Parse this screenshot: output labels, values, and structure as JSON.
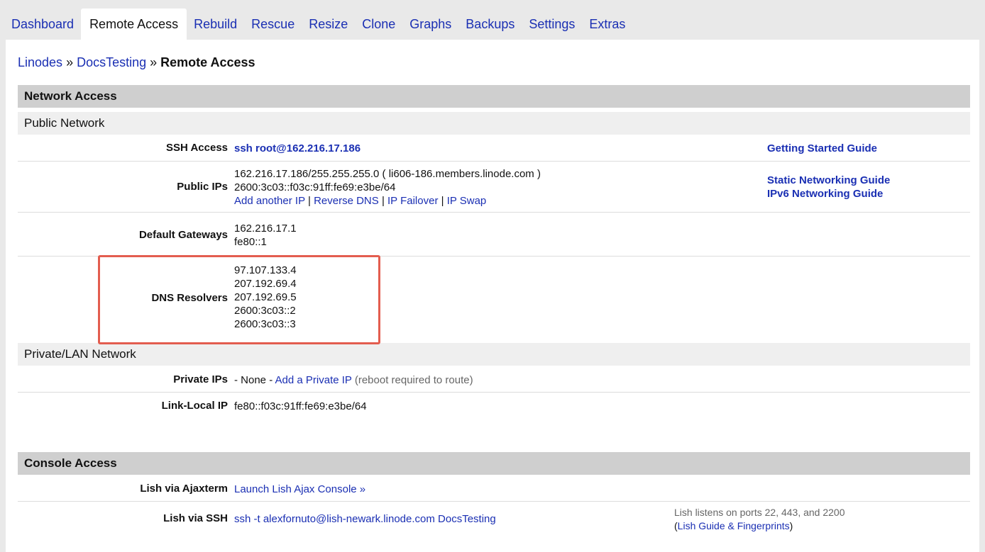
{
  "tabs": [
    {
      "label": "Dashboard"
    },
    {
      "label": "Remote Access",
      "active": true
    },
    {
      "label": "Rebuild"
    },
    {
      "label": "Rescue"
    },
    {
      "label": "Resize"
    },
    {
      "label": "Clone"
    },
    {
      "label": "Graphs"
    },
    {
      "label": "Backups"
    },
    {
      "label": "Settings"
    },
    {
      "label": "Extras"
    }
  ],
  "breadcrumb": {
    "linodes": "Linodes",
    "separator": "»",
    "node": "DocsTesting",
    "current": "Remote Access"
  },
  "network_access": {
    "title": "Network Access",
    "public_network": "Public Network",
    "ssh_access": {
      "label": "SSH Access",
      "value": "ssh root@162.216.17.186",
      "guide": "Getting Started Guide"
    },
    "public_ips": {
      "label": "Public IPs",
      "ipv4": "162.216.17.186/255.255.255.0 ( li606-186.members.linode.com )",
      "ipv6": "2600:3c03::f03c:91ff:fe69:e3be/64",
      "actions": [
        "Add another IP",
        "Reverse DNS",
        "IP Failover",
        "IP Swap"
      ],
      "action_separator": "|",
      "guides": [
        "Static Networking Guide",
        "IPv6 Networking Guide"
      ]
    },
    "default_gateways": {
      "label": "Default Gateways",
      "values": [
        "162.216.17.1",
        "fe80::1"
      ]
    },
    "dns_resolvers": {
      "label": "DNS Resolvers",
      "values": [
        "97.107.133.4",
        "207.192.69.4",
        "207.192.69.5",
        "2600:3c03::2",
        "2600:3c03::3"
      ],
      "highlight_color": "#e35d4f"
    },
    "private_network": "Private/LAN Network",
    "private_ips": {
      "label": "Private IPs",
      "none": "- None -",
      "add": "Add a Private IP",
      "note": "(reboot required to route)"
    },
    "link_local": {
      "label": "Link-Local IP",
      "value": "fe80::f03c:91ff:fe69:e3be/64"
    }
  },
  "console_access": {
    "title": "Console Access",
    "ajaxterm": {
      "label": "Lish via Ajaxterm",
      "link": "Launch Lish Ajax Console »"
    },
    "ssh": {
      "label": "Lish via SSH",
      "value": "ssh -t alexfornuto@lish-newark.linode.com DocsTesting",
      "note": "Lish listens on ports 22, 443, and 2200",
      "guide_open": "(",
      "guide": "Lish Guide & Fingerprints",
      "guide_close": ")"
    }
  },
  "colors": {
    "link": "#1a2fb3",
    "section_header": "#cfcfcf",
    "sub_header": "#efefef",
    "highlight": "#e35d4f"
  }
}
